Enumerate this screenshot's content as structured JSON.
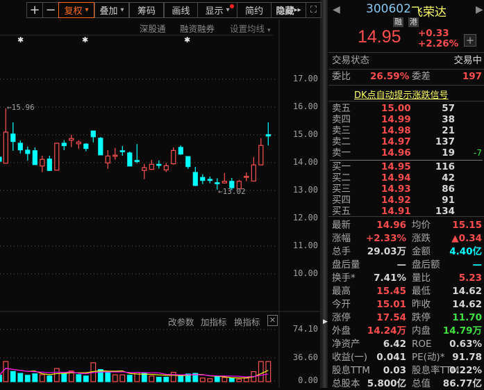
{
  "toolbar": {
    "plus": "+",
    "minus": "−",
    "fuquan": "复权",
    "diejia": "叠加",
    "chouma": "筹码",
    "huaxian": "画线",
    "xianshi": "显示",
    "jianyue": "简约",
    "yincang": "隐藏",
    "dropdown": "▾",
    "hide_arrows": "▸▸",
    "fullscreen": "⛶"
  },
  "subbar": {
    "sgt": "深股通",
    "rzrq": "融资融券",
    "ma_setting": "设置均线"
  },
  "colors": {
    "up": "#ff5050",
    "down": "#00ffff",
    "ma5": "#ffff00",
    "ma10": "#ff00ff",
    "accent": "#ff6a1a"
  },
  "markers": {
    "star": "✱"
  },
  "chart_data": {
    "type": "candlestick",
    "price_axis": {
      "ticks": [
        "17.00",
        "16.00",
        "15.00",
        "14.00",
        "13.00",
        "12.00",
        "11.00",
        "10.00"
      ],
      "range": [
        10,
        17
      ]
    },
    "annotations": {
      "high": "15.96",
      "low": "13.02"
    },
    "candles": [
      [
        14.2,
        14.05,
        14.25,
        14.0
      ],
      [
        13.98,
        15.1,
        15.96,
        13.98
      ],
      [
        15.03,
        14.76,
        15.45,
        14.43
      ],
      [
        14.7,
        14.46,
        14.8,
        14.33
      ],
      [
        14.45,
        14.33,
        14.58,
        14.08
      ],
      [
        14.43,
        13.93,
        14.55,
        13.93
      ],
      [
        13.88,
        14.12,
        14.25,
        13.66
      ],
      [
        14.13,
        13.72,
        14.25,
        13.7
      ],
      [
        13.73,
        14.7,
        14.7,
        13.73
      ],
      [
        14.7,
        14.61,
        14.81,
        14.45
      ],
      [
        14.81,
        14.87,
        15.0,
        14.56
      ],
      [
        14.68,
        14.74,
        14.8,
        14.5
      ],
      [
        14.67,
        14.51,
        14.7,
        14.41
      ],
      [
        15.14,
        14.93,
        15.14,
        14.73
      ],
      [
        14.88,
        14.28,
        14.92,
        14.28
      ],
      [
        13.99,
        14.24,
        14.45,
        13.78
      ],
      [
        14.23,
        14.27,
        14.53,
        14.11
      ],
      [
        14.43,
        14.42,
        14.6,
        14.25
      ],
      [
        14.35,
        13.88,
        14.4,
        13.88
      ],
      [
        14.08,
        14.07,
        14.67,
        13.98
      ],
      [
        13.72,
        13.82,
        13.96,
        13.41
      ],
      [
        13.76,
        13.94,
        14.1,
        13.74
      ],
      [
        13.94,
        13.92,
        14.08,
        13.79
      ],
      [
        13.74,
        13.89,
        13.99,
        13.66
      ],
      [
        13.96,
        14.44,
        14.55,
        13.93
      ],
      [
        14.55,
        14.31,
        14.62,
        14.28
      ],
      [
        14.22,
        13.86,
        14.22,
        13.78
      ],
      [
        13.65,
        13.18,
        13.85,
        13.16
      ],
      [
        13.47,
        13.36,
        13.58,
        13.23
      ],
      [
        13.4,
        13.38,
        13.5,
        13.26
      ],
      [
        13.28,
        13.27,
        13.44,
        13.03
      ],
      [
        13.27,
        13.33,
        13.63,
        13.25
      ],
      [
        13.33,
        13.1,
        13.45,
        13.02
      ],
      [
        13.06,
        13.33,
        13.38,
        13.06
      ],
      [
        13.49,
        13.51,
        13.65,
        13.33
      ],
      [
        13.34,
        13.92,
        14.2,
        13.34
      ],
      [
        13.92,
        14.62,
        14.88,
        13.92
      ],
      [
        15.01,
        14.96,
        15.45,
        14.62
      ]
    ],
    "volume_axis": {
      "ticks": [
        "74.10",
        "36.60",
        "0.00"
      ],
      "range": [
        0,
        74.1
      ]
    },
    "volumes": [
      9.2,
      29,
      14.7,
      11.9,
      9.2,
      11.3,
      10.1,
      8.2,
      18.9,
      11.6,
      15.3,
      10.1,
      8.2,
      27.2,
      17.4,
      12.8,
      9.8,
      9.8,
      9.2,
      13.4,
      11.9,
      8.2,
      6.4,
      6.4,
      13.4,
      9.2,
      11,
      11.9,
      5.2,
      4.3,
      7.3,
      6.1,
      5.2,
      3.7,
      5.2,
      14.4,
      29,
      29.03
    ],
    "volume_up": [
      0,
      1,
      0,
      0,
      0,
      0,
      1,
      0,
      1,
      0,
      1,
      0,
      0,
      1,
      0,
      0,
      1,
      1,
      0,
      1,
      0,
      1,
      0,
      0,
      1,
      0,
      0,
      0,
      1,
      1,
      0,
      1,
      0,
      1,
      1,
      1,
      1,
      1
    ]
  },
  "volume_panel": {
    "gaicanshu": "改参数",
    "jiazhibiao": "加指标",
    "huanzhibiao": "换指标",
    "close": "✕"
  },
  "quote": {
    "code": "300602",
    "name": "飞荣达",
    "badge1": "融",
    "badge2": "港",
    "price": "14.95",
    "change": "+0.33",
    "change_pct": "+2.26%",
    "add": "+",
    "status_label": "交易状态",
    "status_value": "交易中",
    "weibi_label": "委比",
    "weibi": "26.59%",
    "weicha_label": "委差",
    "weicha": "197",
    "dk_link": "DK点自动提示涨跌信号",
    "asks": [
      {
        "label": "卖五",
        "price": "15.00",
        "vol": "57",
        "chg": ""
      },
      {
        "label": "卖四",
        "price": "14.99",
        "vol": "38",
        "chg": ""
      },
      {
        "label": "卖三",
        "price": "14.98",
        "vol": "21",
        "chg": ""
      },
      {
        "label": "卖二",
        "price": "14.97",
        "vol": "137",
        "chg": ""
      },
      {
        "label": "卖一",
        "price": "14.96",
        "vol": "19",
        "chg": "-7"
      }
    ],
    "bids": [
      {
        "label": "买一",
        "price": "14.95",
        "vol": "116"
      },
      {
        "label": "买二",
        "price": "14.94",
        "vol": "42"
      },
      {
        "label": "买三",
        "price": "14.93",
        "vol": "86"
      },
      {
        "label": "买四",
        "price": "14.92",
        "vol": "91"
      },
      {
        "label": "买五",
        "price": "14.91",
        "vol": "134"
      }
    ],
    "stats": [
      {
        "l1": "最新",
        "v1": "14.96",
        "c1": "red",
        "l2": "均价",
        "v2": "15.15",
        "c2": "red"
      },
      {
        "l1": "涨幅",
        "v1": "+2.33%",
        "c1": "red",
        "l2": "涨跌",
        "v2": "▲0.34",
        "c2": "red"
      },
      {
        "l1": "总手",
        "v1": "29.03万",
        "c1": "wh",
        "l2": "金额",
        "v2": "4.40亿",
        "c2": "cy"
      },
      {
        "l1": "盘后量",
        "v1": "—",
        "c1": "wh",
        "l2": "盘后额",
        "v2": "—",
        "c2": "cy"
      },
      {
        "l1": "换手*",
        "v1": "7.41%",
        "c1": "wh",
        "l2": "量比",
        "v2": "5.23",
        "c2": "red"
      },
      {
        "l1": "最高",
        "v1": "15.45",
        "c1": "red",
        "l2": "最低",
        "v2": "14.62",
        "c2": "wh"
      },
      {
        "l1": "今开",
        "v1": "15.01",
        "c1": "red",
        "l2": "昨收",
        "v2": "14.62",
        "c2": "wh"
      },
      {
        "l1": "涨停",
        "v1": "17.54",
        "c1": "red",
        "l2": "跌停",
        "v2": "11.70",
        "c2": "grn"
      },
      {
        "l1": "外盘",
        "v1": "14.24万",
        "c1": "red",
        "l2": "内盘",
        "v2": "14.79万",
        "c2": "grn"
      },
      {
        "l1": "净资产",
        "v1": "6.42",
        "c1": "wh",
        "l2": "ROE",
        "v2": "0.63%",
        "c2": "wh"
      },
      {
        "l1": "收益(一)",
        "v1": "0.041",
        "c1": "wh",
        "l2": "PE(动)*",
        "v2": "91.78",
        "c2": "wh"
      },
      {
        "l1": "股息TTM",
        "v1": "0.03",
        "c1": "wh",
        "l2": "股息率TTM",
        "v2": "0.22%",
        "c2": "wh"
      },
      {
        "l1": "总股本",
        "v1": "5.800亿",
        "c1": "wh",
        "l2": "总值",
        "v2": "86.77亿",
        "c2": "wh"
      }
    ]
  }
}
